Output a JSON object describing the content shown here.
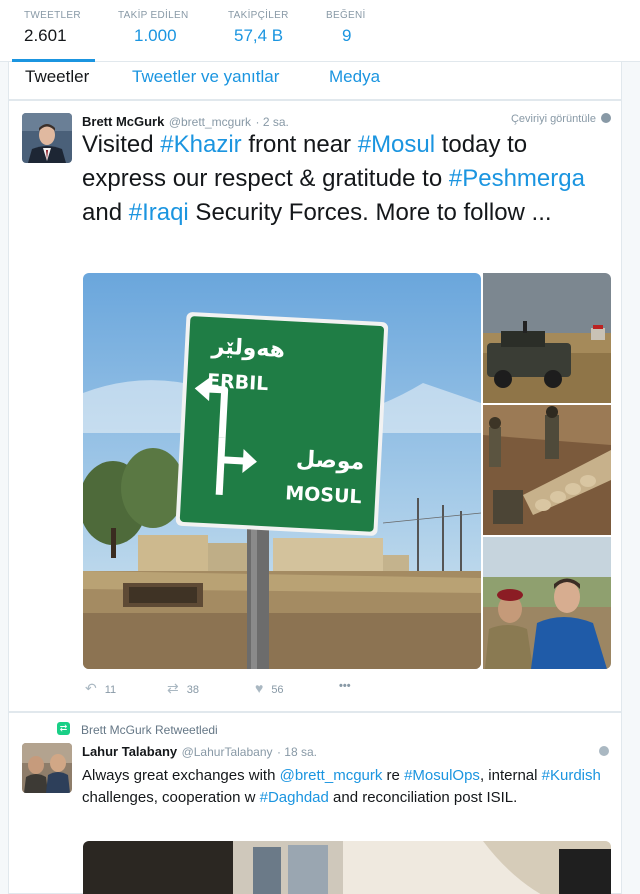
{
  "stats": [
    {
      "label": "TWEETLER",
      "value": "2.601"
    },
    {
      "label": "TAKİP EDİLEN",
      "value": "1.000"
    },
    {
      "label": "TAKİPÇİLER",
      "value": "57,4 B"
    },
    {
      "label": "BEĞENİ",
      "value": "9"
    }
  ],
  "tabs": [
    "Tweetler",
    "Tweetler ve yanıtlar",
    "Medya"
  ],
  "tweet1": {
    "name": "Brett McGurk",
    "handle": "@brett_mcgurk",
    "time": "· 2 sa.",
    "translate": "Çeviriyi görüntüle",
    "text": {
      "p1": "Visited ",
      "h1": "#Khazir",
      "p2": " front near ",
      "h2": "#Mosul",
      "p3": " today to express our respect & gratitude to ",
      "h3": "#Peshmerga",
      "p4": " and ",
      "h4": "#Iraqi",
      "p5": " Security Forces. More to follow ..."
    },
    "sign": {
      "arabic_top": "هەولێر",
      "english_top": "ERBIL",
      "arabic_bottom": "موصل",
      "english_bottom": "MOSUL"
    },
    "actions": {
      "reply_count": "11",
      "retweet_count": "38",
      "like_count": "56",
      "more": "•••"
    }
  },
  "tweet2": {
    "retweeted_by": "Brett McGurk Retweetledi",
    "name": "Lahur Talabany",
    "handle": "@LahurTalabany",
    "time": "· 18 sa.",
    "text": {
      "p1": "Always great exchanges with ",
      "m1": "@brett_mcgurk",
      "p2": " re ",
      "h1": "#MosulOps",
      "p3": ", internal ",
      "h2": "#Kurdish",
      "p4": " challenges, cooperation w ",
      "h3": "#Daghdad",
      "p5": " and reconciliation post ISIL."
    }
  },
  "colors": {
    "accent": "#1b95e0",
    "muted": "#8899a6",
    "retweet": "#19cf86",
    "sign_green": "#1f7d45"
  }
}
